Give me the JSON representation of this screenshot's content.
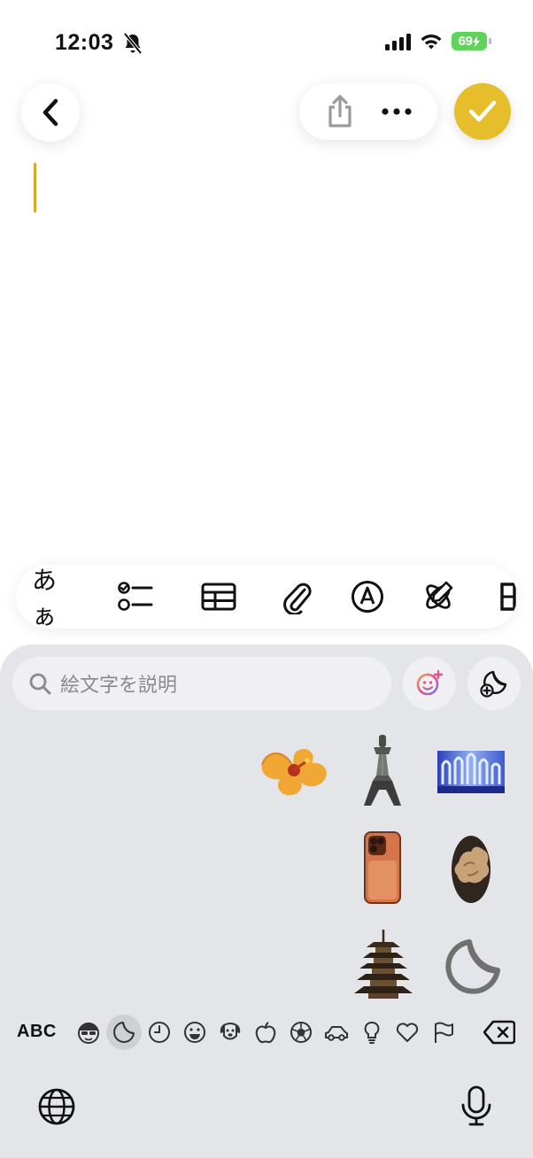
{
  "status_bar": {
    "time": "12:03",
    "battery": "69"
  },
  "nav": {
    "back": "back",
    "share": "share",
    "more": "more",
    "done": "done"
  },
  "toolbar": {
    "text_format_label": "あぁ"
  },
  "emoji_keyboard": {
    "search_placeholder": "絵文字を説明",
    "abc_label": "ABC",
    "categories": [
      "memoji",
      "stickers",
      "recent",
      "smileys",
      "animals",
      "food",
      "activity",
      "travel",
      "objects",
      "symbols",
      "flags"
    ],
    "selected_category": "stickers",
    "stickers": [
      "hibiscus-flower",
      "tower",
      "blue-waveform-art",
      "orange-phone-case",
      "mushroom-photo",
      "pagoda",
      "add-sticker-peel"
    ]
  },
  "colors": {
    "accent": "#e6bd2b",
    "keyboard_bg": "#e4e5e9",
    "battery": "#5fd35a"
  }
}
